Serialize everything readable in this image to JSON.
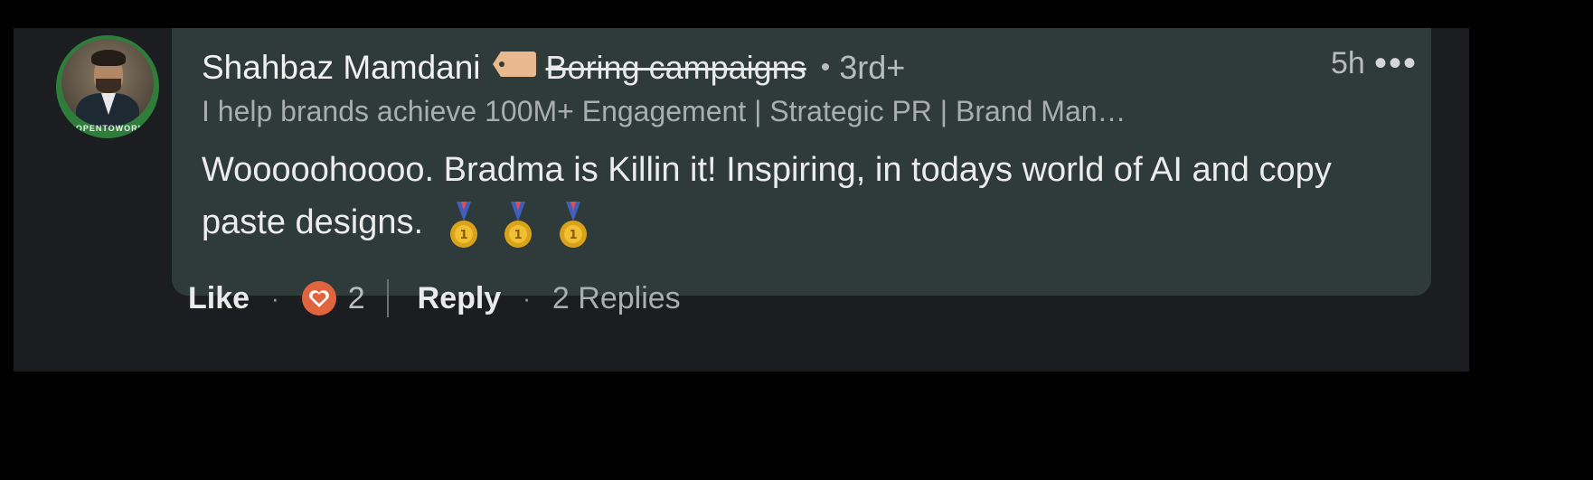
{
  "comment": {
    "author_name": "Shahbaz Mamdani",
    "author_tag": "Boring campaigns",
    "separator": "•",
    "connection_degree": "3rd+",
    "timestamp": "5h",
    "more_label": "•••",
    "headline": "I help brands achieve 100M+ Engagement | Strategic PR | Brand Man…",
    "text": "Wooooohoooo. Bradma is Killin it! Inspiring, in todays world of AI and copy paste designs.",
    "avatar_badge_text": "#OPENTOWORK"
  },
  "actions": {
    "like_label": "Like",
    "dot": "·",
    "reaction_count": "2",
    "reply_label": "Reply",
    "replies_label": "2 Replies"
  },
  "icons": {
    "tag": "tag-icon",
    "medals": [
      "medal-icon",
      "medal-icon",
      "medal-icon"
    ],
    "reaction": "heart-reaction-icon",
    "more": "more-icon"
  },
  "colors": {
    "background": "#000000",
    "panel": "#1b1d20",
    "bubble": "#2f3a3b",
    "open_to_work_green": "#2f7d3a",
    "reaction_orange": "#e0643d",
    "medal_gold": "#d9a21b"
  }
}
